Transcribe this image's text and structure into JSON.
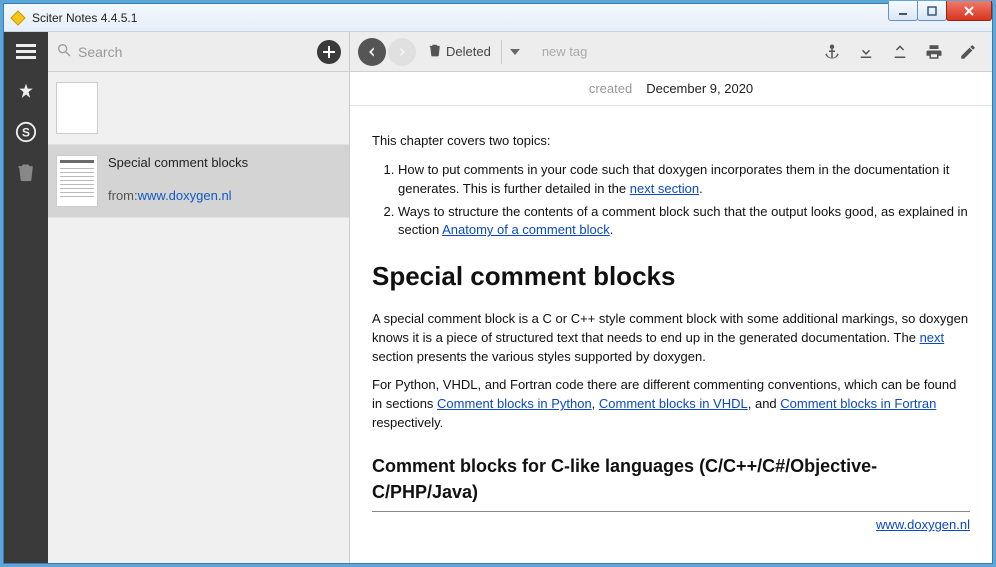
{
  "window": {
    "title": "Sciter Notes 4.4.5.1"
  },
  "search": {
    "placeholder": "Search"
  },
  "notes": [
    {
      "title": "",
      "from_label": "",
      "from_url": "",
      "selected": false,
      "has_content": false
    },
    {
      "title": "Special comment blocks",
      "from_label": "from:",
      "from_url": "www.doxygen.nl",
      "selected": true,
      "has_content": true
    }
  ],
  "toolbar": {
    "deleted_label": "Deleted",
    "newtag_placeholder": "new tag"
  },
  "meta": {
    "created_label": "created",
    "created_value": "December 9, 2020"
  },
  "doc": {
    "intro": "This chapter covers two topics:",
    "li1_a": "How to put comments in your code such that doxygen incorporates them in the documentation it generates. This is further detailed in the ",
    "li1_link": "next section",
    "li1_b": ".",
    "li2_a": "Ways to structure the contents of a comment block such that the output looks good, as explained in section ",
    "li2_link": "Anatomy of a comment block",
    "li2_b": ".",
    "h1": "Special comment blocks",
    "p1_a": "A special comment block is a C or C++ style comment block with some additional markings, so doxygen knows it is a piece of structured text that needs to end up in the generated documentation. The ",
    "p1_link": "next",
    "p1_b": " section presents the various styles supported by doxygen.",
    "p2_a": "For Python, VHDL, and Fortran code there are different commenting conventions, which can be found in sections ",
    "p2_link1": "Comment blocks in Python",
    "p2_sep1": ", ",
    "p2_link2": "Comment blocks in VHDL",
    "p2_sep2": ", and ",
    "p2_link3": "Comment blocks in Fortran",
    "p2_b": " respectively.",
    "h2": "Comment blocks for C-like languages (C/C++/C#/Objective-C/PHP/Java)",
    "src_link": "www.doxygen.nl"
  }
}
